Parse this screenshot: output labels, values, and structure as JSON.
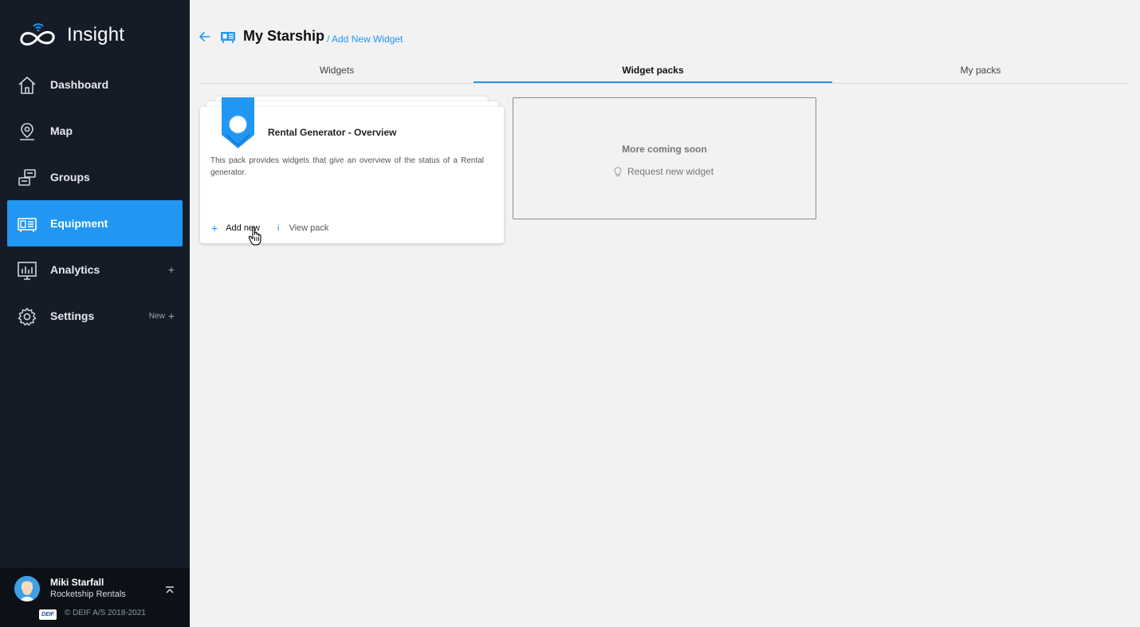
{
  "app": {
    "name": "Insight"
  },
  "sidebar": {
    "items": [
      {
        "label": "Dashboard",
        "icon": "home-icon"
      },
      {
        "label": "Map",
        "icon": "map-pin-icon"
      },
      {
        "label": "Groups",
        "icon": "groups-icon"
      },
      {
        "label": "Equipment",
        "icon": "equipment-icon",
        "active": true
      },
      {
        "label": "Analytics",
        "icon": "analytics-icon",
        "action": "+"
      },
      {
        "label": "Settings",
        "icon": "gear-icon",
        "badge": "New",
        "action": "+"
      }
    ]
  },
  "user": {
    "name": "Miki Starfall",
    "org": "Rocketship Rentals",
    "brand": "DEIF",
    "copyright": "© DEIF A/S 2018-2021"
  },
  "header": {
    "title": "My Starship",
    "breadcrumb": "/ Add New Widget"
  },
  "tabs": [
    {
      "label": "Widgets"
    },
    {
      "label": "Widget packs",
      "active": true
    },
    {
      "label": "My packs"
    }
  ],
  "pack": {
    "title": "Rental Generator - Overview",
    "description": "This pack provides widgets that give an overview of the status of a Rental generator.",
    "add_symbol": "+",
    "add_label": "Add new",
    "view_symbol": "i",
    "view_label": "View pack"
  },
  "coming_soon": {
    "title": "More coming soon",
    "request_label": "Request new widget"
  },
  "colors": {
    "accent": "#2196f3",
    "sidebar_bg": "#151c28",
    "page_bg": "#f2f2f2"
  }
}
